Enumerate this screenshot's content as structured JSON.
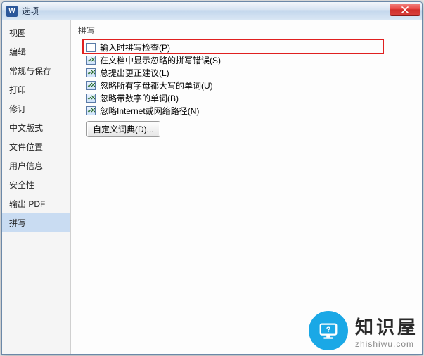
{
  "window": {
    "app_icon_letter": "W",
    "title": "选项",
    "close_aria": "关闭"
  },
  "sidebar": {
    "items": [
      {
        "label": "视图"
      },
      {
        "label": "编辑"
      },
      {
        "label": "常规与保存"
      },
      {
        "label": "打印"
      },
      {
        "label": "修订"
      },
      {
        "label": "中文版式"
      },
      {
        "label": "文件位置"
      },
      {
        "label": "用户信息"
      },
      {
        "label": "安全性"
      },
      {
        "label": "输出 PDF"
      },
      {
        "label": "拼写",
        "active": true
      }
    ]
  },
  "content": {
    "group_label": "拼写",
    "options": [
      {
        "label": "输入时拼写检查(P)",
        "checked": false,
        "highlighted": true
      },
      {
        "label": "在文档中显示忽略的拼写错误(S)",
        "checked": true
      },
      {
        "label": "总提出更正建议(L)",
        "checked": true
      },
      {
        "label": "忽略所有字母都大写的单词(U)",
        "checked": true
      },
      {
        "label": "忽略带数字的单词(B)",
        "checked": true
      },
      {
        "label": "忽略Internet或网络路径(N)",
        "checked": true
      }
    ],
    "custom_dict_button": "自定义词典(D)..."
  },
  "watermark": {
    "title": "知识屋",
    "url": "zhishiwu.com"
  }
}
